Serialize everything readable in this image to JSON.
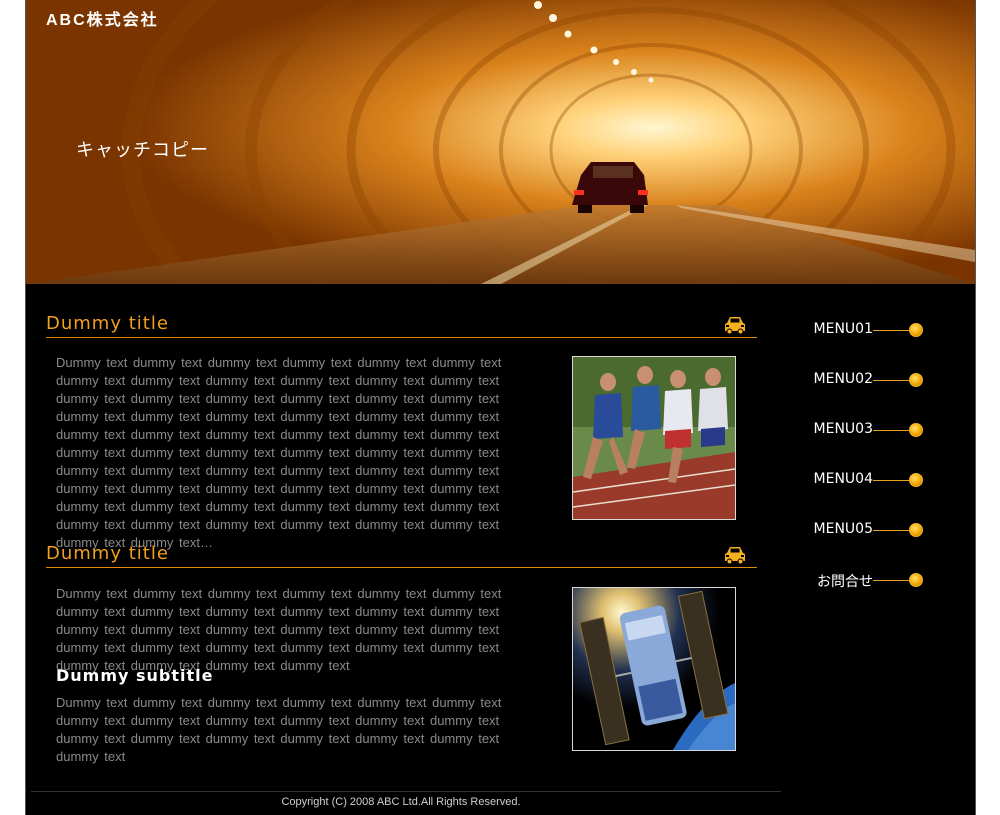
{
  "header": {
    "logo": "ABC株式会社",
    "catch_copy": "キャッチコピー"
  },
  "sections": [
    {
      "title": "Dummy title",
      "icon": "car-icon",
      "body": "Dummy text dummy text  dummy text  dummy text  dummy text  dummy text  dummy text  dummy text  dummy text dummy text  dummy text  dummy text  dummy text  dummy text  dummy text  dummy text  dummy text  dummy text dummy text  dummy text  dummy text  dummy text  dummy text  dummy text  dummy text  dummy text  dummy text  dummy text  dummy text  dummy text  dummy text  dummy text  dummy text  dummy text  dummy text  dummy text  dummy text dummy text  dummy text  dummy text  dummy text  dummy text  dummy text  dummy text  dummy text dummy text  dummy text  dummy text  dummy text  dummy text  dummy text  dummy text  dummy text  dummy text  dummy text  dummy text dummy text  dummy text  dummy text  dummy text  dummy text  dummy text…",
      "photo": "runners-photo"
    },
    {
      "title": "Dummy title",
      "icon": "car-icon",
      "body": "Dummy text dummy text  dummy text  dummy text  dummy text  dummy text  dummy text  dummy text  dummy text dummy text  dummy text  dummy text  dummy text  dummy text  dummy text  dummy text  dummy text  dummy text dummy text  dummy text  dummy text  dummy text  dummy text  dummy text  dummy text  dummy text  dummy text dummy text",
      "subtitle": "Dummy subtitle",
      "body2": "Dummy text dummy text  dummy text  dummy text  dummy text  dummy text  dummy text  dummy text  dummy text dummy text  dummy text  dummy text  dummy text  dummy text  dummy text  dummy text  dummy text dummy text  dummy text",
      "photo": "satellite-photo"
    }
  ],
  "menu": [
    {
      "label": "MENU01"
    },
    {
      "label": "MENU02"
    },
    {
      "label": "MENU03"
    },
    {
      "label": "MENU04"
    },
    {
      "label": "MENU05"
    },
    {
      "label": "お問合せ"
    }
  ],
  "footer": {
    "copyright": "Copyright (C) 2008 ABC Ltd.All Rights Reserved."
  },
  "colors": {
    "accent": "#f0a020",
    "background": "#000000",
    "body_text": "#8a8a8a"
  }
}
